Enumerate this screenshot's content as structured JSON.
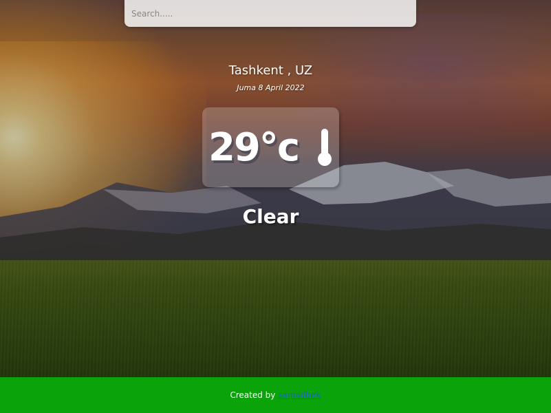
{
  "search": {
    "placeholder": "Search.....",
    "value": ""
  },
  "weather": {
    "location": "Tashkent , UZ",
    "date": "Juma 8 April 2022",
    "temperature": "29°c",
    "condition": "Clear",
    "icon": "thermometer-icon"
  },
  "footer": {
    "prefix": "Created by",
    "link_text": "samadbek"
  },
  "colors": {
    "footer_bg": "#0aa30a",
    "link": "#1e5fd8",
    "text": "#ffffff"
  }
}
